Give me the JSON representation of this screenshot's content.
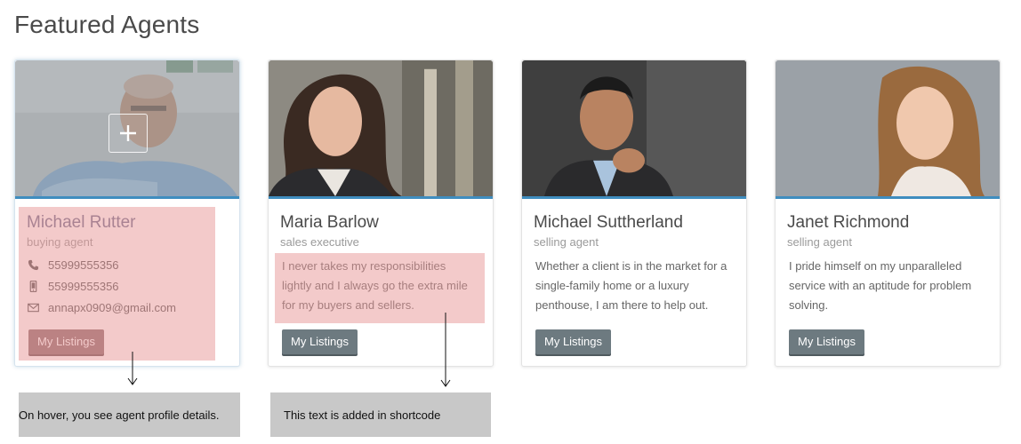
{
  "section_title": "Featured Agents",
  "agents": [
    {
      "name": "Michael Rutter",
      "role": "buying agent",
      "phone": "55999555356",
      "mobile": "55999555356",
      "email": "annapx0909@gmail.com",
      "button": "My Listings"
    },
    {
      "name": "Maria Barlow",
      "role": "sales executive",
      "bio_lines": [
        "I never takes my responsibilities",
        "lightly and I always go the extra mile",
        "for my buyers and sellers."
      ],
      "button": "My Listings"
    },
    {
      "name": "Michael Suttherland",
      "role": "selling agent",
      "bio_lines": [
        "Whether a client is in the market for a",
        "single-family home or a luxury",
        "penthouse, I am there to help out."
      ],
      "button": "My Listings"
    },
    {
      "name": "Janet Richmond",
      "role": "selling agent",
      "bio_lines": [
        "I pride himself on my unparalleled",
        "service with an aptitude for problem",
        "solving."
      ],
      "button": "My Listings"
    }
  ],
  "annotations": {
    "hover_note": "On hover, you see agent profile details.",
    "shortcode_note": "This text is added in shortcode"
  },
  "colors": {
    "accent_bar": "#3f8dbf",
    "button": "#6d7a80",
    "highlight": "#e89696",
    "note_bg": "#c8c8c8"
  }
}
